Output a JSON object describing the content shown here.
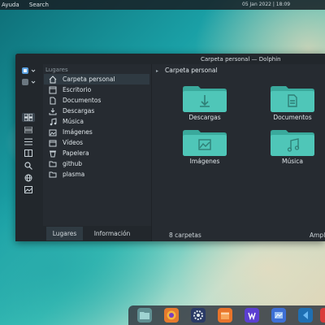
{
  "topbar": {
    "menu": [
      "Ayuda",
      "Search"
    ],
    "clock": "05 Jan 2022 | 18:09"
  },
  "window": {
    "title": "Carpeta personal — Dolphin"
  },
  "sidebar": {
    "header": "Lugares",
    "items": [
      {
        "label": "Carpeta personal",
        "icon": "home-icon",
        "active": true
      },
      {
        "label": "Escritorio",
        "icon": "desktop-icon"
      },
      {
        "label": "Documentos",
        "icon": "documents-icon"
      },
      {
        "label": "Descargas",
        "icon": "downloads-icon"
      },
      {
        "label": "Música",
        "icon": "music-icon"
      },
      {
        "label": "Imágenes",
        "icon": "pictures-icon"
      },
      {
        "label": "Vídeos",
        "icon": "videos-icon"
      },
      {
        "label": "Papelera",
        "icon": "trash-icon"
      },
      {
        "label": "github",
        "icon": "folder-icon"
      },
      {
        "label": "plasma",
        "icon": "folder-icon"
      }
    ],
    "tabs": [
      "Lugares",
      "Información"
    ]
  },
  "content": {
    "breadcrumb": "Carpeta personal",
    "folders": [
      {
        "label": "Descargas",
        "icon": "download-arrow-icon"
      },
      {
        "label": "Documentos",
        "icon": "document-page-icon"
      },
      {
        "label": "Imágenes",
        "icon": "image-icon"
      },
      {
        "label": "Música",
        "icon": "music-note-icon"
      }
    ],
    "status_count": "8 carpetas",
    "status_zoom": "Ampliación"
  },
  "colors": {
    "folder": "#4fc6b8",
    "folder_dark": "#3aa99c",
    "accent": "#2f3a42"
  }
}
